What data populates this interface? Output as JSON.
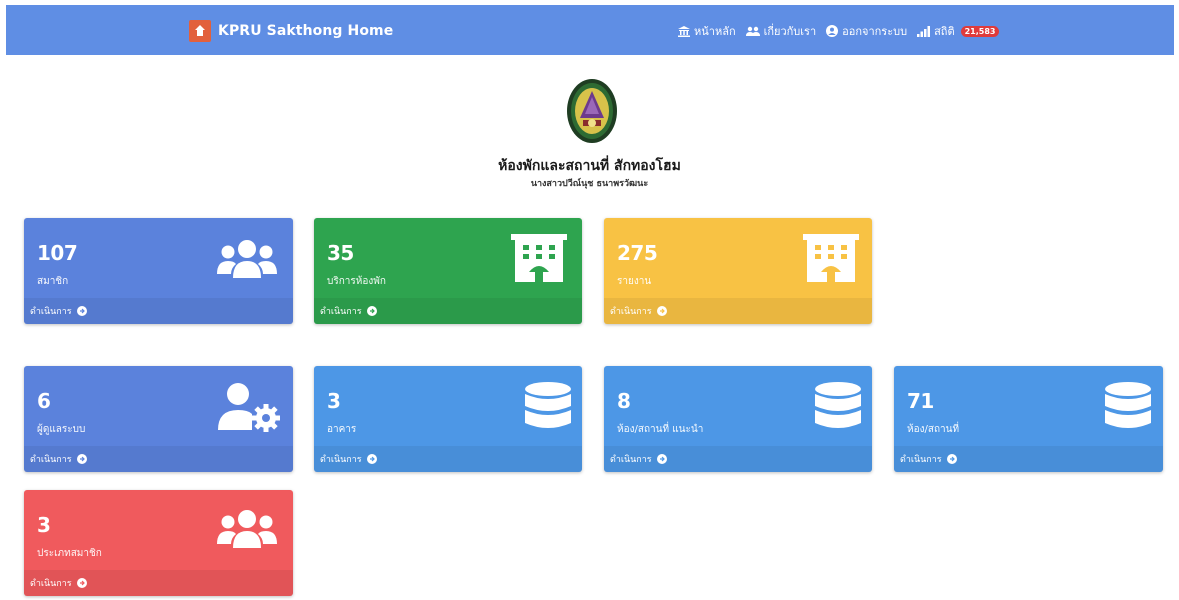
{
  "navbar": {
    "brand": "KPRU Sakthong Home",
    "links": {
      "home": "หน้าหลัก",
      "about": "เกี่ยวกับเรา",
      "logout": "ออกจากระบบ",
      "stats": "สถิติ",
      "stats_badge": "21,583"
    }
  },
  "header": {
    "title": "ห้องพักและสถานที่ สักทองโฮม",
    "subtitle": "นางสาวปวีณ์นุช ธนาพรวัฒนะ"
  },
  "cards": [
    {
      "count": "107",
      "label": "สมาชิก",
      "action": "ดำเนินการ",
      "color": "#5b82dc",
      "icon": "users-icon"
    },
    {
      "count": "35",
      "label": "บริการห้องพัก",
      "action": "ดำเนินการ",
      "color": "#2ea44f",
      "icon": "hotel-icon"
    },
    {
      "count": "275",
      "label": "รายงาน",
      "action": "ดำเนินการ",
      "color": "#f8c244",
      "icon": "hotel-icon"
    },
    {
      "count": "6",
      "label": "ผู้ดูแลระบบ",
      "action": "ดำเนินการ",
      "color": "#5b82dc",
      "icon": "user-gear-icon"
    },
    {
      "count": "3",
      "label": "อาคาร",
      "action": "ดำเนินการ",
      "color": "#4d97e6",
      "icon": "database-icon"
    },
    {
      "count": "8",
      "label": "ห้อง/สถานที่ แนะนำ",
      "action": "ดำเนินการ",
      "color": "#4d97e6",
      "icon": "database-icon"
    },
    {
      "count": "71",
      "label": "ห้อง/สถานที่",
      "action": "ดำเนินการ",
      "color": "#4d97e6",
      "icon": "database-icon"
    },
    {
      "count": "3",
      "label": "ประเภทสมาชิก",
      "action": "ดำเนินการ",
      "color": "#f05a5d",
      "icon": "users-icon"
    }
  ]
}
